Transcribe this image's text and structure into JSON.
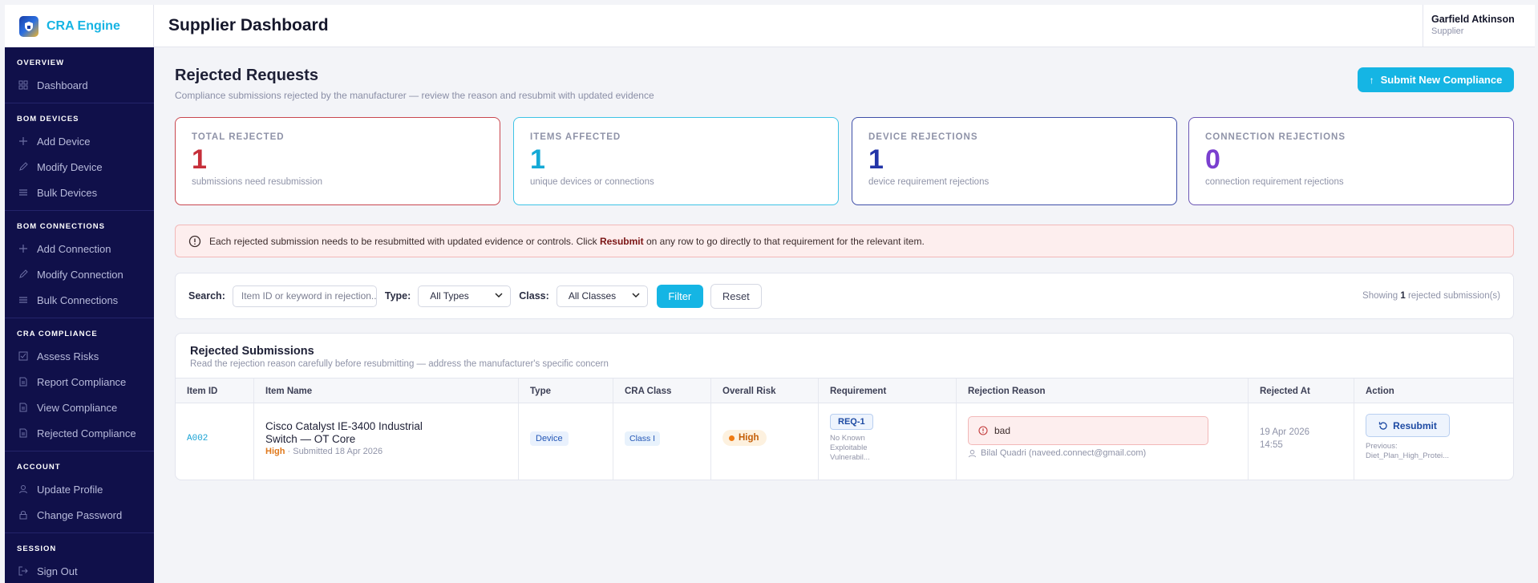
{
  "brand": {
    "name": "CRA Engine"
  },
  "header": {
    "title": "Supplier Dashboard",
    "user_name": "Garfield Atkinson",
    "user_role": "Supplier"
  },
  "sidebar": {
    "sections": [
      {
        "heading": "OVERVIEW",
        "items": [
          {
            "label": "Dashboard",
            "icon": "grid-icon"
          }
        ]
      },
      {
        "heading": "BOM DEVICES",
        "items": [
          {
            "label": "Add Device",
            "icon": "plus-icon"
          },
          {
            "label": "Modify Device",
            "icon": "pencil-icon"
          },
          {
            "label": "Bulk Devices",
            "icon": "list-icon"
          }
        ]
      },
      {
        "heading": "BOM CONNECTIONS",
        "items": [
          {
            "label": "Add Connection",
            "icon": "plus-icon"
          },
          {
            "label": "Modify Connection",
            "icon": "pencil-icon"
          },
          {
            "label": "Bulk Connections",
            "icon": "list-icon"
          }
        ]
      },
      {
        "heading": "CRA COMPLIANCE",
        "items": [
          {
            "label": "Assess Risks",
            "icon": "checkbox-icon"
          },
          {
            "label": "Report Compliance",
            "icon": "document-icon"
          },
          {
            "label": "View Compliance",
            "icon": "document-icon"
          },
          {
            "label": "Rejected Compliance",
            "icon": "document-icon"
          }
        ]
      },
      {
        "heading": "ACCOUNT",
        "items": [
          {
            "label": "Update Profile",
            "icon": "user-icon"
          },
          {
            "label": "Change Password",
            "icon": "lock-icon"
          }
        ]
      },
      {
        "heading": "SESSION",
        "items": [
          {
            "label": "Sign Out",
            "icon": "sign-out-icon"
          }
        ]
      }
    ]
  },
  "main": {
    "title": "Rejected Requests",
    "subtitle": "Compliance submissions rejected by the manufacturer — review the reason and resubmit with updated evidence",
    "submit_button": "Submit New Compliance",
    "stats": [
      {
        "label": "TOTAL REJECTED",
        "value": "1",
        "desc": "submissions need resubmission",
        "color": "#c62f3a",
        "border": "#c9474f"
      },
      {
        "label": "ITEMS AFFECTED",
        "value": "1",
        "desc": "unique devices or connections",
        "color": "#14a9d6",
        "border": "#3ec3e6"
      },
      {
        "label": "DEVICE REJECTIONS",
        "value": "1",
        "desc": "device requirement rejections",
        "color": "#2335a8",
        "border": "#3e4ea8"
      },
      {
        "label": "CONNECTION REJECTIONS",
        "value": "0",
        "desc": "connection requirement rejections",
        "color": "#7a3fcf",
        "border": "#6a55b4"
      }
    ],
    "alert": {
      "text_before": "Each rejected submission needs to be resubmitted with updated evidence or controls. Click ",
      "bold": "Resubmit",
      "text_after": " on any row to go directly to that requirement for the relevant item."
    },
    "filters": {
      "search_label": "Search:",
      "search_placeholder": "Item ID or keyword in rejection...",
      "type_label": "Type:",
      "type_value": "All Types",
      "class_label": "Class:",
      "class_value": "All Classes",
      "filter_button": "Filter",
      "reset_button": "Reset",
      "showing_prefix": "Showing ",
      "showing_count": "1",
      "showing_suffix": " rejected submission(s)"
    },
    "table": {
      "title": "Rejected Submissions",
      "subtitle": "Read the rejection reason carefully before resubmitting — address the manufacturer's specific concern",
      "columns": [
        "Item ID",
        "Item Name",
        "Type",
        "CRA Class",
        "Overall Risk",
        "Requirement",
        "Rejection Reason",
        "Rejected At",
        "Action"
      ],
      "rows": [
        {
          "item_id": "A002",
          "item_name": "Cisco Catalyst IE-3400 Industrial Switch — OT Core",
          "risk_tag": "High",
          "submitted": " · Submitted 18 Apr 2026",
          "type": "Device",
          "cra_class": "Class I",
          "overall_risk": "High",
          "requirement": "REQ-1",
          "requirement_desc": "No Known Exploitable Vulnerabil...",
          "reason": "bad",
          "rejected_by": "Bilal Quadri (naveed.connect@gmail.com)",
          "rejected_date": "19 Apr 2026",
          "rejected_time": "14:55",
          "action": "Resubmit",
          "previous_label": "Previous:",
          "previous_file": "Diet_Plan_High_Protei..."
        }
      ]
    }
  }
}
